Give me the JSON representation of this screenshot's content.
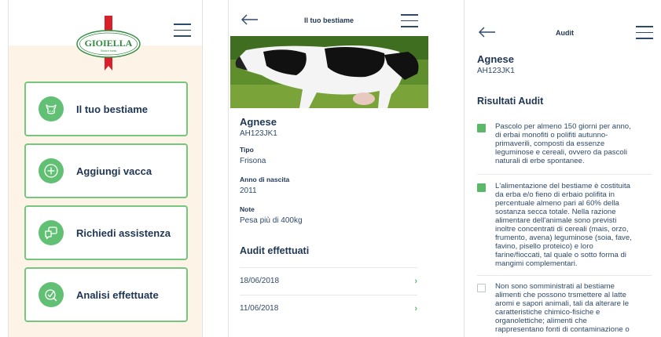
{
  "screen1": {
    "logo": {
      "brand": "GIOIELLA",
      "tagline": "Gusto e bontà"
    },
    "tiles": [
      {
        "label": "Il tuo bestiame",
        "icon": "cow-icon"
      },
      {
        "label": "Aggiungi vacca",
        "icon": "plus-circle-icon"
      },
      {
        "label": "Richiedi assistenza",
        "icon": "chat-bubbles-icon"
      },
      {
        "label": "Analisi effettuate",
        "icon": "analysis-icon"
      }
    ]
  },
  "screen2": {
    "title": "Il tuo bestiame",
    "cow": {
      "name": "Agnese",
      "code": "AH123JK1"
    },
    "fields": [
      {
        "label": "Tipo",
        "value": "Frisona"
      },
      {
        "label": "Anno di nascita",
        "value": "2011"
      },
      {
        "label": "Note",
        "value": "Pesa più di 400kg"
      }
    ],
    "audits_title": "Audit effettuati",
    "audits": [
      "18/06/2018",
      "11/06/2018"
    ]
  },
  "screen3": {
    "title": "Audit",
    "cow": {
      "name": "Agnese",
      "code": "AH123JK1"
    },
    "results_title": "Risultati Audit",
    "results": [
      {
        "checked": true,
        "lines": [
          "Pascolo per almeno 150 giorni per anno,",
          "di erbai monofiti o polifiti autunno-",
          "primaverili, composti da essenze",
          "leguminose e cereali, ovvero da pascoli",
          "naturali di erbe spontanee."
        ]
      },
      {
        "checked": true,
        "lines": [
          "L'alimentazione del bestiame è costituita",
          "da erba e/o fieno di erbaio polifita in",
          "percentuale almeno pari al 60% della",
          "sostanza secca totale. Nella razione",
          "alimentare dell'animale sono previsti",
          "inoltre concentrati di cereali (mais, orzo,",
          "frumento, avena) leguminose (soia, fave,",
          "favino, pisello proteico) e loro",
          "farine/fioccati, tal quale o sotto forma di",
          "mangimi complementari."
        ]
      },
      {
        "checked": false,
        "lines": [
          "Non sono somministrati al bestiame",
          "alimenti che possono trsmettere al latte",
          "aromi e sapori animali, tali da alterare le",
          "caratteristiche chimico-fisiche e",
          "organolettiche; alimenti che",
          "rappresentano fonti di contaminazione o"
        ]
      }
    ]
  },
  "colors": {
    "accent_green": "#5cb869",
    "navy": "#1f3554",
    "cream": "#fdf3e6",
    "logo_red": "#d9202a"
  }
}
